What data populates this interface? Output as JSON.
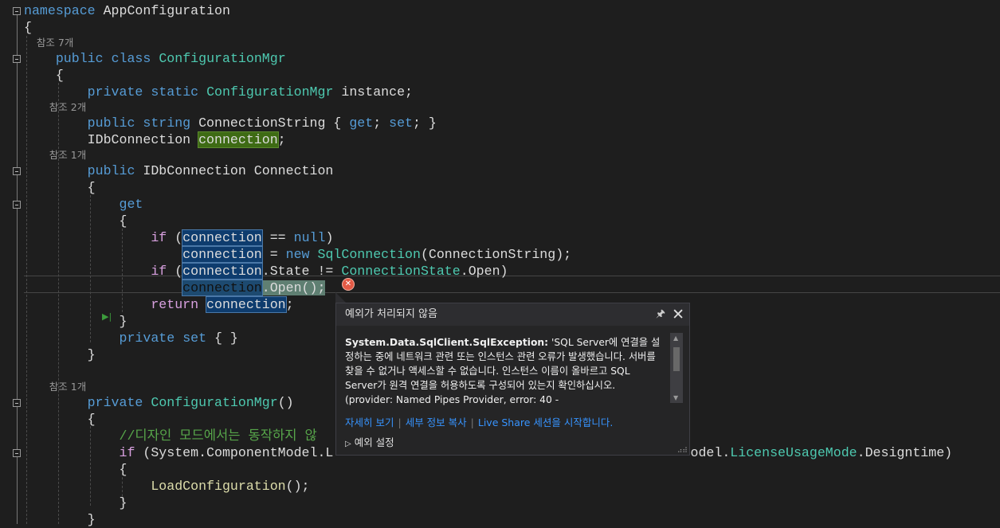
{
  "colors": {
    "background": "#1e1e1e",
    "keyword": "#569cd6",
    "type": "#4ec9b0",
    "control": "#d8a0df",
    "method": "#dcdcaa",
    "comment": "#57a64a",
    "error": "#e35a46",
    "link": "#3794ff"
  },
  "code": [
    {
      "fold": true,
      "tokens": [
        [
          "namespace",
          "k"
        ],
        [
          " AppConfiguration",
          "p"
        ]
      ]
    },
    {
      "tokens": [
        [
          "{",
          "p"
        ]
      ]
    },
    {
      "lens": true,
      "tokens": [
        [
          "    참조 7개",
          "lens"
        ]
      ]
    },
    {
      "fold": true,
      "tokens": [
        [
          "    ",
          "p"
        ],
        [
          "public",
          "k"
        ],
        [
          " ",
          "p"
        ],
        [
          "class",
          "k"
        ],
        [
          " ",
          "p"
        ],
        [
          "ConfigurationMgr",
          "t"
        ]
      ]
    },
    {
      "tokens": [
        [
          "    {",
          "p"
        ]
      ]
    },
    {
      "tokens": [
        [
          "        ",
          "p"
        ],
        [
          "private",
          "k"
        ],
        [
          " ",
          "p"
        ],
        [
          "static",
          "k"
        ],
        [
          " ",
          "p"
        ],
        [
          "ConfigurationMgr",
          "t"
        ],
        [
          " instance;",
          "p"
        ]
      ]
    },
    {
      "lens": true,
      "tokens": [
        [
          "        참조 2개",
          "lens"
        ]
      ]
    },
    {
      "tokens": [
        [
          "        ",
          "p"
        ],
        [
          "public",
          "k"
        ],
        [
          " ",
          "p"
        ],
        [
          "string",
          "k"
        ],
        [
          " ConnectionString { ",
          "p"
        ],
        [
          "get",
          "k"
        ],
        [
          "; ",
          "p"
        ],
        [
          "set",
          "k"
        ],
        [
          "; }",
          "p"
        ]
      ]
    },
    {
      "tokens": [
        [
          "        IDbConnection ",
          "p"
        ],
        [
          "connection",
          "hg"
        ],
        [
          ";",
          "p"
        ]
      ]
    },
    {
      "lens": true,
      "tokens": [
        [
          "        참조 1개",
          "lens"
        ]
      ]
    },
    {
      "fold": true,
      "tokens": [
        [
          "        ",
          "p"
        ],
        [
          "public",
          "k"
        ],
        [
          " IDbConnection Connection",
          "p"
        ]
      ]
    },
    {
      "tokens": [
        [
          "        {",
          "p"
        ]
      ]
    },
    {
      "fold": true,
      "tokens": [
        [
          "            ",
          "p"
        ],
        [
          "get",
          "k"
        ]
      ]
    },
    {
      "tokens": [
        [
          "            {",
          "p"
        ]
      ]
    },
    {
      "tokens": [
        [
          "                ",
          "p"
        ],
        [
          "if",
          "c"
        ],
        [
          " (",
          "p"
        ],
        [
          "connection",
          "hl"
        ],
        [
          " == ",
          "p"
        ],
        [
          "null",
          "k"
        ],
        [
          ")",
          "p"
        ]
      ]
    },
    {
      "tokens": [
        [
          "                    ",
          "p"
        ],
        [
          "connection",
          "hl"
        ],
        [
          " = ",
          "p"
        ],
        [
          "new",
          "k"
        ],
        [
          " ",
          "p"
        ],
        [
          "SqlConnection",
          "t"
        ],
        [
          "(ConnectionString);",
          "p"
        ]
      ]
    },
    {
      "tokens": [
        [
          "                ",
          "p"
        ],
        [
          "if",
          "c"
        ],
        [
          " (",
          "p"
        ],
        [
          "connection",
          "hl"
        ],
        [
          ".State != ",
          "p"
        ],
        [
          "ConnectionState",
          "t"
        ],
        [
          ".Open)",
          "p"
        ]
      ]
    },
    {
      "current": true,
      "tokens": [
        [
          "                    ",
          "p"
        ],
        [
          "connection",
          "hlcur"
        ],
        [
          ".Open();",
          "cur"
        ]
      ]
    },
    {
      "tokens": [
        [
          "                ",
          "p"
        ],
        [
          "return",
          "c"
        ],
        [
          " ",
          "p"
        ],
        [
          "connection",
          "hl"
        ],
        [
          ";",
          "p"
        ]
      ]
    },
    {
      "tokens": [
        [
          "            }",
          "p"
        ]
      ]
    },
    {
      "tokens": [
        [
          "            ",
          "p"
        ],
        [
          "private",
          "k"
        ],
        [
          " ",
          "p"
        ],
        [
          "set",
          "k"
        ],
        [
          " { }",
          "p"
        ]
      ]
    },
    {
      "tokens": [
        [
          "        }",
          "p"
        ]
      ]
    },
    {
      "tokens": [
        [
          "",
          "p"
        ]
      ]
    },
    {
      "lens": true,
      "tokens": [
        [
          "        참조 1개",
          "lens"
        ]
      ]
    },
    {
      "fold": true,
      "tokens": [
        [
          "        ",
          "p"
        ],
        [
          "private",
          "k"
        ],
        [
          " ",
          "p"
        ],
        [
          "ConfigurationMgr",
          "t"
        ],
        [
          "()",
          "p"
        ]
      ]
    },
    {
      "tokens": [
        [
          "        {",
          "p"
        ]
      ]
    },
    {
      "tokens": [
        [
          "            ",
          "p"
        ],
        [
          "//디자인 모드에서는 동작하지 않",
          "cm"
        ]
      ]
    },
    {
      "fold": true,
      "tokens": [
        [
          "            ",
          "p"
        ],
        [
          "if",
          "c"
        ],
        [
          " (System.ComponentModel.L",
          "p"
        ],
        [
          "                                             ",
          "p"
        ],
        [
          "odel.",
          "p"
        ],
        [
          "LicenseUsageMode",
          "t"
        ],
        [
          ".Designtime)",
          "p"
        ]
      ]
    },
    {
      "tokens": [
        [
          "            {",
          "p"
        ]
      ]
    },
    {
      "tokens": [
        [
          "                ",
          "p"
        ],
        [
          "LoadConfiguration",
          "m"
        ],
        [
          "();",
          "p"
        ]
      ]
    },
    {
      "tokens": [
        [
          "            }",
          "p"
        ]
      ]
    },
    {
      "tokens": [
        [
          "        }",
          "p"
        ]
      ]
    }
  ],
  "popup": {
    "title": "예외가 처리되지 않음",
    "pin_icon": "pin-icon",
    "close_icon": "close-icon",
    "exception_type": "System.Data.SqlClient.SqlException:",
    "message": " 'SQL Server에 연결을 설정하는 중에 네트워크 관련 또는 인스턴스 관련 오류가 발생했습니다. 서버를 찾을 수 없거나 액세스할 수 없습니다. 인스턴스 이름이 올바르고 SQL Server가 원격 연결을 허용하도록 구성되어 있는지 확인하십시오. (provider: Named Pipes Provider, error: 40 -",
    "links": [
      "자세히 보기",
      "세부 정보 복사",
      "Live Share 세션을 시작합니다."
    ],
    "settings_label": "예외 설정"
  }
}
